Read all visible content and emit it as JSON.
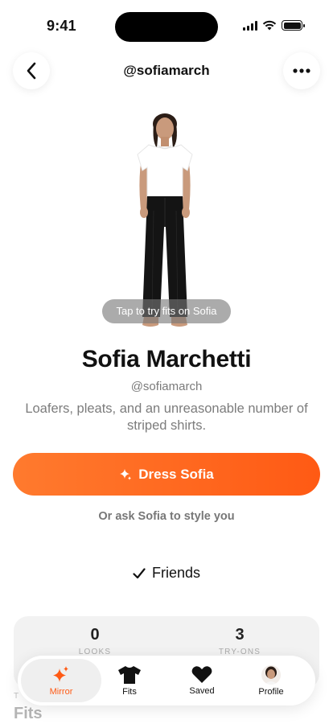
{
  "status_bar": {
    "time": "9:41"
  },
  "header": {
    "title": "@sofiamarch"
  },
  "avatar": {
    "try_label": "Tap to try fits on Sofia"
  },
  "profile": {
    "name": "Sofia Marchetti",
    "handle": "@sofiamarch",
    "bio": "Loafers, pleats, and an unreasonable number of striped shirts."
  },
  "actions": {
    "dress_label": "Dress Sofia",
    "ask_label": "Or ask Sofia to style you",
    "friends_label": "Friends"
  },
  "stats": [
    {
      "value": "0",
      "label": "LOOKS"
    },
    {
      "value": "3",
      "label": "TRY-ONS"
    }
  ],
  "section_peek": {
    "kicker": "T",
    "title": "Fits"
  },
  "tabbar": {
    "tabs": [
      {
        "label": "Mirror",
        "icon": "sparkles-icon",
        "active": true
      },
      {
        "label": "Fits",
        "icon": "tshirt-icon"
      },
      {
        "label": "Saved",
        "icon": "heart-icon"
      },
      {
        "label": "Profile",
        "icon": "avatar"
      }
    ]
  },
  "colors": {
    "accent": "#ff5a14",
    "accent_light": "#ff7a2e"
  }
}
